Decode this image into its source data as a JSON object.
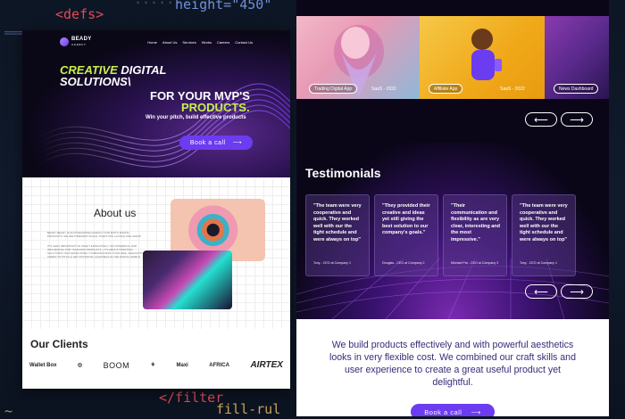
{
  "background_code": {
    "line1": "<defs>",
    "line2": "height=\"450\"",
    "line3": "</filter",
    "line4": "fill-rul"
  },
  "colors": {
    "accent": "#6b3cf0",
    "lime": "#c8f04a",
    "mission_text": "#3b2a7a"
  },
  "landing": {
    "logo": {
      "name": "BEADY",
      "sub": "AGENCY"
    },
    "nav": [
      "Home",
      "About Us",
      "Services",
      "Works",
      "Careers",
      "Contact Us"
    ],
    "hero": {
      "line1_lime": "CREATIVE",
      "line1_rest": " DIGITAL",
      "line2": "SOLUTIONS\\",
      "line3": "FOR YOUR MVP'S",
      "line4_lime": "PRODUCTS.",
      "subtitle": "Win your pitch, build effective products",
      "button_label": "Book a call",
      "button_icon": "arrow-right-icon"
    },
    "about": {
      "title": "About us",
      "para1": "BEADY BEADY IS AN INTEGRATED AGENCY FOR MVP'S DIGITAL PRODUCTS. WE HELP BRANDS SCALE, START-UPS LAUNCH AND GROW",
      "para2": "IT'S VERY IMPORTANT TO CRAFT EFFECTIVELY YET POWERFUL AND INFLUENTIAL FOR YOUR MVP PRODUCTS - IT'S ABOUT CRAFTING SOLUTIONS THAT EFFECTIVELY COMMUNICATES YOUR IDEA, DELIGHTFUL USERS TO PITCH & GET POTENTIAL CHANNELS IN THE DIGITAL WORLD"
    },
    "clients": {
      "title": "Our Clients",
      "logos": [
        "Wallet Box",
        "◎",
        "BOOM",
        "⚘",
        "Maxi",
        "AFRICA",
        "AIRTEX"
      ]
    }
  },
  "right": {
    "portfolio": [
      {
        "tag": "Trading Digital App",
        "extra": "SaaS - 2022"
      },
      {
        "tag": "Affiliate App",
        "extra": "SaaS - 2022"
      },
      {
        "tag": "News Dashboard",
        "extra": ""
      }
    ],
    "testimonials_title": "Testimonials",
    "testimonials": [
      {
        "quote": "\"The team were very cooperative and quick. They worked well with our the tight schedule and were always on top\"",
        "author": "Tony - CEO at Company 1"
      },
      {
        "quote": "\"They provided their creative and ideas yet still giving the best solution to our company's goals.\"",
        "author": "Douglas - CEO at Company 2"
      },
      {
        "quote": "\"Their communication and flexibility as are very clear, interesting and the most impressive.\"",
        "author": "Michael Pat - CEO at Company 3"
      },
      {
        "quote": "\"The team were very cooperative and quick. They worked well with our the tight schedule and were always on top\"",
        "author": "Tony - CEO at Company 1"
      }
    ],
    "mission": "We build products effectively and with powerful aesthetics looks in very flexible cost. We combined our craft skills and user experience to create a great useful product yet delightful.",
    "mission_button": "Book a call"
  }
}
